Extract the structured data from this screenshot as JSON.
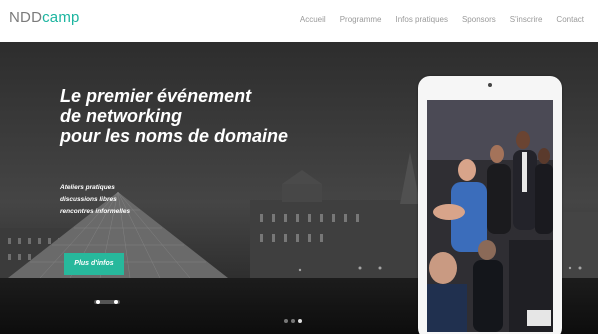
{
  "brand": {
    "prefix": "NDD",
    "suffix": "camp",
    "accent_color": "#1cb5a0"
  },
  "nav": {
    "items": [
      {
        "label": "Accueil"
      },
      {
        "label": "Programme"
      },
      {
        "label": "Infos pratiques"
      },
      {
        "label": "Sponsors"
      },
      {
        "label": "S'inscrire"
      },
      {
        "label": "Contact"
      }
    ]
  },
  "hero": {
    "headline": [
      "Le premier événement",
      "de networking",
      "pour les noms de domaine"
    ],
    "features": [
      "Ateliers pratiques",
      "discussions libres",
      "rencontres informelles"
    ],
    "cta_label": "Plus d'infos",
    "cta_color": "#27b89c",
    "carousel": {
      "count": 3,
      "active": 2
    }
  },
  "icons": {
    "tablet_camera": "camera-dot-icon"
  }
}
